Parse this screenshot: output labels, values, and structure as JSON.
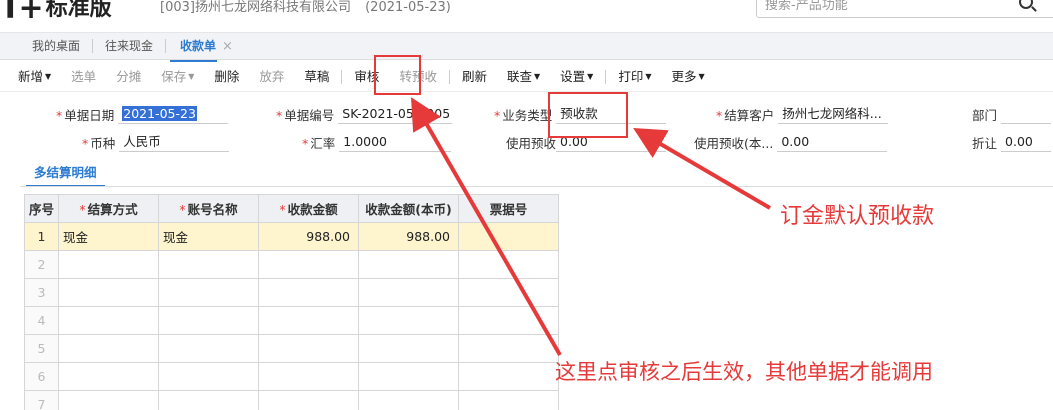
{
  "header": {
    "logo_mark": "T+",
    "logo_text": "标准版",
    "company_code": "[003]扬州七龙网络科技有限公司",
    "company_date": "(2021-05-23)",
    "search_placeholder": "搜索-产品功能"
  },
  "tabs": [
    {
      "label": "我的桌面"
    },
    {
      "label": "往来现金"
    },
    {
      "label": "收款单",
      "active": true
    }
  ],
  "tab_close": "×",
  "toolbar": {
    "items": [
      {
        "label": "新增",
        "caret": true,
        "disabled": false
      },
      {
        "label": "选单",
        "caret": false,
        "disabled": true
      },
      {
        "label": "分摊",
        "caret": false,
        "disabled": true
      },
      {
        "label": "保存",
        "caret": true,
        "disabled": true
      },
      {
        "label": "删除",
        "caret": false,
        "disabled": false
      },
      {
        "label": "放弃",
        "caret": false,
        "disabled": true
      },
      {
        "label": "草稿",
        "caret": false,
        "disabled": false
      },
      {
        "label": "审核",
        "caret": false,
        "disabled": false
      },
      {
        "label": "转预收",
        "caret": false,
        "disabled": true
      },
      {
        "label": "刷新",
        "caret": false,
        "disabled": false
      },
      {
        "label": "联查",
        "caret": true,
        "disabled": false
      },
      {
        "label": "设置",
        "caret": true,
        "disabled": false
      },
      {
        "label": "打印",
        "caret": true,
        "disabled": false
      },
      {
        "label": "更多",
        "caret": true,
        "disabled": false
      }
    ],
    "caret_glyph": "▼"
  },
  "form": {
    "date_label": "单据日期",
    "date_value": "2021-05-23",
    "code_label": "单据编号",
    "code_value": "SK-2021-05-0005",
    "type_label": "业务类型",
    "type_value": "预收款",
    "customer_label": "结算客户",
    "customer_value": "扬州七龙网络科...",
    "dept_label": "部门",
    "dept_value": "",
    "currency_label": "币种",
    "currency_value": "人民币",
    "rate_label": "汇率",
    "rate_value": "1.0000",
    "prepay_label": "使用预收",
    "prepay_value": "0.00",
    "prepay_base_label": "使用预收(本...",
    "prepay_base_value": "0.00",
    "discount_label": "折让",
    "discount_value": "0.00",
    "required_mark": "*"
  },
  "subtab": "多结算明细",
  "table": {
    "headers": [
      {
        "label": "序号",
        "required": false
      },
      {
        "label": "结算方式",
        "required": true
      },
      {
        "label": "账号名称",
        "required": true
      },
      {
        "label": "收款金额",
        "required": true
      },
      {
        "label": "收款金额(本币)",
        "required": false
      },
      {
        "label": "票据号",
        "required": false
      }
    ],
    "rows": [
      {
        "seq": "1",
        "method": "现金",
        "account": "现金",
        "amount": "988.00",
        "amount_base": "988.00",
        "ticket": ""
      },
      {
        "seq": "2",
        "method": "",
        "account": "",
        "amount": "",
        "amount_base": "",
        "ticket": ""
      },
      {
        "seq": "3",
        "method": "",
        "account": "",
        "amount": "",
        "amount_base": "",
        "ticket": ""
      },
      {
        "seq": "4",
        "method": "",
        "account": "",
        "amount": "",
        "amount_base": "",
        "ticket": ""
      },
      {
        "seq": "5",
        "method": "",
        "account": "",
        "amount": "",
        "amount_base": "",
        "ticket": ""
      },
      {
        "seq": "6",
        "method": "",
        "account": "",
        "amount": "",
        "amount_base": "",
        "ticket": ""
      },
      {
        "seq": "7",
        "method": "",
        "account": "",
        "amount": "",
        "amount_base": "",
        "ticket": ""
      }
    ]
  },
  "annotations": {
    "deposit_note": "订金默认预收款",
    "audit_note": "这里点审核之后生效，其他单据才能调用"
  },
  "colors": {
    "accent": "#2d7cd2",
    "annotation": "#e63a3a",
    "selected_row": "#fef5cf",
    "selection": "#3470d6"
  }
}
